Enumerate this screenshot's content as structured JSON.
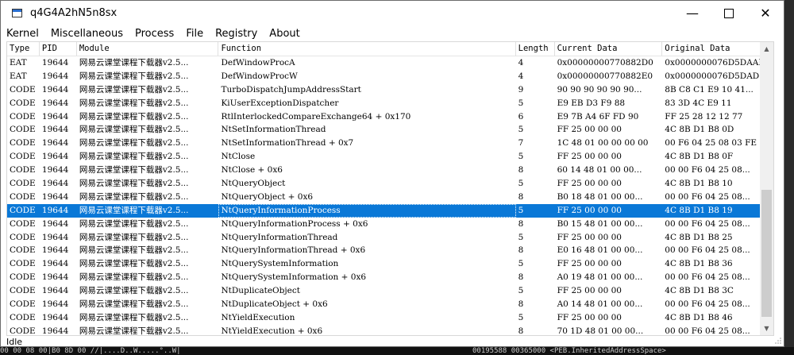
{
  "window": {
    "title": "q4G4A2hN5n8sx"
  },
  "menu": [
    "Kernel",
    "Miscellaneous",
    "Process",
    "File",
    "Registry",
    "About"
  ],
  "columns": [
    "Type",
    "PID",
    "Module",
    "Function",
    "Length",
    "Current Data",
    "Original Data"
  ],
  "rows": [
    [
      "EAT",
      "19644",
      "网易云课堂课程下载器v2.5...",
      "DefWindowProcA",
      "4",
      "0x00000000770882D0",
      "0x0000000076D5DAAD"
    ],
    [
      "EAT",
      "19644",
      "网易云课堂课程下载器v2.5...",
      "DefWindowProcW",
      "4",
      "0x00000000770882E0",
      "0x0000000076D5DAD7"
    ],
    [
      "CODE",
      "19644",
      "网易云课堂课程下载器v2.5...",
      "TurboDispatchJumpAddressStart",
      "9",
      "90 90 90 90 90 90...",
      "8B C8 C1 E9 10 41..."
    ],
    [
      "CODE",
      "19644",
      "网易云课堂课程下载器v2.5...",
      "KiUserExceptionDispatcher",
      "5",
      "E9 EB D3 F9 88",
      "83 3D 4C E9 11"
    ],
    [
      "CODE",
      "19644",
      "网易云课堂课程下载器v2.5...",
      "RtlInterlockedCompareExchange64 + 0x170",
      "6",
      "E9 7B A4 6F FD 90",
      "FF 25 28 12 12 77"
    ],
    [
      "CODE",
      "19644",
      "网易云课堂课程下载器v2.5...",
      "NtSetInformationThread",
      "5",
      "FF 25 00 00 00",
      "4C 8B D1 B8 0D"
    ],
    [
      "CODE",
      "19644",
      "网易云课堂课程下载器v2.5...",
      "NtSetInformationThread + 0x7",
      "7",
      "1C 48 01 00 00 00 00",
      "00 F6 04 25 08 03 FE"
    ],
    [
      "CODE",
      "19644",
      "网易云课堂课程下载器v2.5...",
      "NtClose",
      "5",
      "FF 25 00 00 00",
      "4C 8B D1 B8 0F"
    ],
    [
      "CODE",
      "19644",
      "网易云课堂课程下载器v2.5...",
      "NtClose + 0x6",
      "8",
      "60 14 48 01 00 00...",
      "00 00 F6 04 25 08..."
    ],
    [
      "CODE",
      "19644",
      "网易云课堂课程下载器v2.5...",
      "NtQueryObject",
      "5",
      "FF 25 00 00 00",
      "4C 8B D1 B8 10"
    ],
    [
      "CODE",
      "19644",
      "网易云课堂课程下载器v2.5...",
      "NtQueryObject + 0x6",
      "8",
      "B0 18 48 01 00 00...",
      "00 00 F6 04 25 08..."
    ],
    [
      "CODE",
      "19644",
      "网易云课堂课程下载器v2.5...",
      "NtQueryInformationProcess",
      "5",
      "FF 25 00 00 00",
      "4C 8B D1 B8 19"
    ],
    [
      "CODE",
      "19644",
      "网易云课堂课程下载器v2.5...",
      "NtQueryInformationProcess + 0x6",
      "8",
      "B0 15 48 01 00 00...",
      "00 00 F6 04 25 08..."
    ],
    [
      "CODE",
      "19644",
      "网易云课堂课程下载器v2.5...",
      "NtQueryInformationThread",
      "5",
      "FF 25 00 00 00",
      "4C 8B D1 B8 25"
    ],
    [
      "CODE",
      "19644",
      "网易云课堂课程下载器v2.5...",
      "NtQueryInformationThread + 0x6",
      "8",
      "E0 16 48 01 00 00...",
      "00 00 F6 04 25 08..."
    ],
    [
      "CODE",
      "19644",
      "网易云课堂课程下载器v2.5...",
      "NtQuerySystemInformation",
      "5",
      "FF 25 00 00 00",
      "4C 8B D1 B8 36"
    ],
    [
      "CODE",
      "19644",
      "网易云课堂课程下载器v2.5...",
      "NtQuerySystemInformation + 0x6",
      "8",
      "A0 19 48 01 00 00...",
      "00 00 F6 04 25 08..."
    ],
    [
      "CODE",
      "19644",
      "网易云课堂课程下载器v2.5...",
      "NtDuplicateObject",
      "5",
      "FF 25 00 00 00",
      "4C 8B D1 B8 3C"
    ],
    [
      "CODE",
      "19644",
      "网易云课堂课程下载器v2.5...",
      "NtDuplicateObject + 0x6",
      "8",
      "A0 14 48 01 00 00...",
      "00 00 F6 04 25 08..."
    ],
    [
      "CODE",
      "19644",
      "网易云课堂课程下载器v2.5...",
      "NtYieldExecution",
      "5",
      "FF 25 00 00 00",
      "4C 8B D1 B8 46"
    ],
    [
      "CODE",
      "19644",
      "网易云课堂课程下载器v2.5...",
      "NtYieldExecution + 0x6",
      "8",
      "70 1D 48 01 00 00...",
      "00 00 F6 04 25 08..."
    ]
  ],
  "selected_row": 11,
  "status": "Idle",
  "background_text": "00 00 08 00|B0 8D 00 //|....D..W.....°..W|",
  "background_text_right": "00195588  00365000  <PEB.InheritedAddressSpace>",
  "colors": {
    "selection": "#0a78d7"
  }
}
